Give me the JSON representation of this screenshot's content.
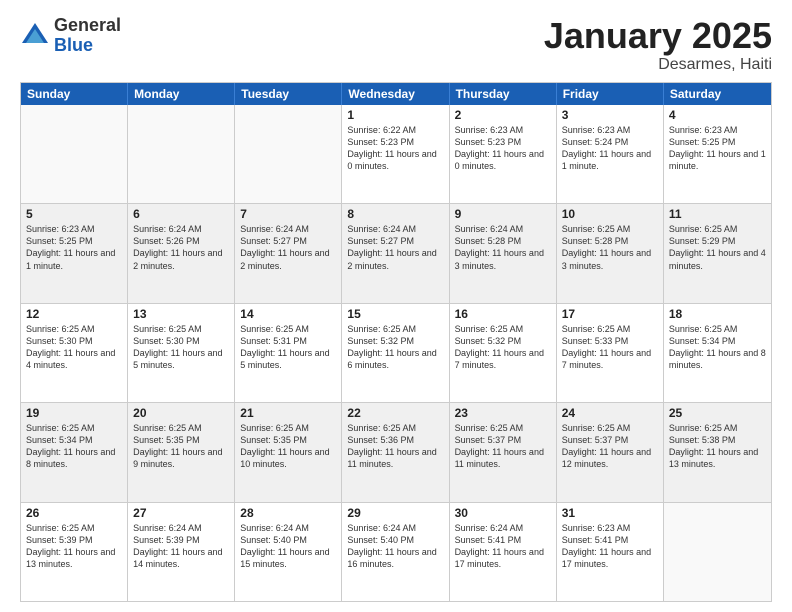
{
  "logo": {
    "general": "General",
    "blue": "Blue"
  },
  "title": {
    "month": "January 2025",
    "location": "Desarmes, Haiti"
  },
  "header": {
    "days": [
      "Sunday",
      "Monday",
      "Tuesday",
      "Wednesday",
      "Thursday",
      "Friday",
      "Saturday"
    ]
  },
  "rows": [
    [
      {
        "day": "",
        "sunrise": "",
        "sunset": "",
        "daylight": "",
        "empty": true
      },
      {
        "day": "",
        "sunrise": "",
        "sunset": "",
        "daylight": "",
        "empty": true
      },
      {
        "day": "",
        "sunrise": "",
        "sunset": "",
        "daylight": "",
        "empty": true
      },
      {
        "day": "1",
        "sunrise": "Sunrise: 6:22 AM",
        "sunset": "Sunset: 5:23 PM",
        "daylight": "Daylight: 11 hours and 0 minutes."
      },
      {
        "day": "2",
        "sunrise": "Sunrise: 6:23 AM",
        "sunset": "Sunset: 5:23 PM",
        "daylight": "Daylight: 11 hours and 0 minutes."
      },
      {
        "day": "3",
        "sunrise": "Sunrise: 6:23 AM",
        "sunset": "Sunset: 5:24 PM",
        "daylight": "Daylight: 11 hours and 1 minute."
      },
      {
        "day": "4",
        "sunrise": "Sunrise: 6:23 AM",
        "sunset": "Sunset: 5:25 PM",
        "daylight": "Daylight: 11 hours and 1 minute."
      }
    ],
    [
      {
        "day": "5",
        "sunrise": "Sunrise: 6:23 AM",
        "sunset": "Sunset: 5:25 PM",
        "daylight": "Daylight: 11 hours and 1 minute."
      },
      {
        "day": "6",
        "sunrise": "Sunrise: 6:24 AM",
        "sunset": "Sunset: 5:26 PM",
        "daylight": "Daylight: 11 hours and 2 minutes."
      },
      {
        "day": "7",
        "sunrise": "Sunrise: 6:24 AM",
        "sunset": "Sunset: 5:27 PM",
        "daylight": "Daylight: 11 hours and 2 minutes."
      },
      {
        "day": "8",
        "sunrise": "Sunrise: 6:24 AM",
        "sunset": "Sunset: 5:27 PM",
        "daylight": "Daylight: 11 hours and 2 minutes."
      },
      {
        "day": "9",
        "sunrise": "Sunrise: 6:24 AM",
        "sunset": "Sunset: 5:28 PM",
        "daylight": "Daylight: 11 hours and 3 minutes."
      },
      {
        "day": "10",
        "sunrise": "Sunrise: 6:25 AM",
        "sunset": "Sunset: 5:28 PM",
        "daylight": "Daylight: 11 hours and 3 minutes."
      },
      {
        "day": "11",
        "sunrise": "Sunrise: 6:25 AM",
        "sunset": "Sunset: 5:29 PM",
        "daylight": "Daylight: 11 hours and 4 minutes."
      }
    ],
    [
      {
        "day": "12",
        "sunrise": "Sunrise: 6:25 AM",
        "sunset": "Sunset: 5:30 PM",
        "daylight": "Daylight: 11 hours and 4 minutes."
      },
      {
        "day": "13",
        "sunrise": "Sunrise: 6:25 AM",
        "sunset": "Sunset: 5:30 PM",
        "daylight": "Daylight: 11 hours and 5 minutes."
      },
      {
        "day": "14",
        "sunrise": "Sunrise: 6:25 AM",
        "sunset": "Sunset: 5:31 PM",
        "daylight": "Daylight: 11 hours and 5 minutes."
      },
      {
        "day": "15",
        "sunrise": "Sunrise: 6:25 AM",
        "sunset": "Sunset: 5:32 PM",
        "daylight": "Daylight: 11 hours and 6 minutes."
      },
      {
        "day": "16",
        "sunrise": "Sunrise: 6:25 AM",
        "sunset": "Sunset: 5:32 PM",
        "daylight": "Daylight: 11 hours and 7 minutes."
      },
      {
        "day": "17",
        "sunrise": "Sunrise: 6:25 AM",
        "sunset": "Sunset: 5:33 PM",
        "daylight": "Daylight: 11 hours and 7 minutes."
      },
      {
        "day": "18",
        "sunrise": "Sunrise: 6:25 AM",
        "sunset": "Sunset: 5:34 PM",
        "daylight": "Daylight: 11 hours and 8 minutes."
      }
    ],
    [
      {
        "day": "19",
        "sunrise": "Sunrise: 6:25 AM",
        "sunset": "Sunset: 5:34 PM",
        "daylight": "Daylight: 11 hours and 8 minutes."
      },
      {
        "day": "20",
        "sunrise": "Sunrise: 6:25 AM",
        "sunset": "Sunset: 5:35 PM",
        "daylight": "Daylight: 11 hours and 9 minutes."
      },
      {
        "day": "21",
        "sunrise": "Sunrise: 6:25 AM",
        "sunset": "Sunset: 5:35 PM",
        "daylight": "Daylight: 11 hours and 10 minutes."
      },
      {
        "day": "22",
        "sunrise": "Sunrise: 6:25 AM",
        "sunset": "Sunset: 5:36 PM",
        "daylight": "Daylight: 11 hours and 11 minutes."
      },
      {
        "day": "23",
        "sunrise": "Sunrise: 6:25 AM",
        "sunset": "Sunset: 5:37 PM",
        "daylight": "Daylight: 11 hours and 11 minutes."
      },
      {
        "day": "24",
        "sunrise": "Sunrise: 6:25 AM",
        "sunset": "Sunset: 5:37 PM",
        "daylight": "Daylight: 11 hours and 12 minutes."
      },
      {
        "day": "25",
        "sunrise": "Sunrise: 6:25 AM",
        "sunset": "Sunset: 5:38 PM",
        "daylight": "Daylight: 11 hours and 13 minutes."
      }
    ],
    [
      {
        "day": "26",
        "sunrise": "Sunrise: 6:25 AM",
        "sunset": "Sunset: 5:39 PM",
        "daylight": "Daylight: 11 hours and 13 minutes."
      },
      {
        "day": "27",
        "sunrise": "Sunrise: 6:24 AM",
        "sunset": "Sunset: 5:39 PM",
        "daylight": "Daylight: 11 hours and 14 minutes."
      },
      {
        "day": "28",
        "sunrise": "Sunrise: 6:24 AM",
        "sunset": "Sunset: 5:40 PM",
        "daylight": "Daylight: 11 hours and 15 minutes."
      },
      {
        "day": "29",
        "sunrise": "Sunrise: 6:24 AM",
        "sunset": "Sunset: 5:40 PM",
        "daylight": "Daylight: 11 hours and 16 minutes."
      },
      {
        "day": "30",
        "sunrise": "Sunrise: 6:24 AM",
        "sunset": "Sunset: 5:41 PM",
        "daylight": "Daylight: 11 hours and 17 minutes."
      },
      {
        "day": "31",
        "sunrise": "Sunrise: 6:23 AM",
        "sunset": "Sunset: 5:41 PM",
        "daylight": "Daylight: 11 hours and 17 minutes."
      },
      {
        "day": "",
        "sunrise": "",
        "sunset": "",
        "daylight": "",
        "empty": true
      }
    ]
  ]
}
